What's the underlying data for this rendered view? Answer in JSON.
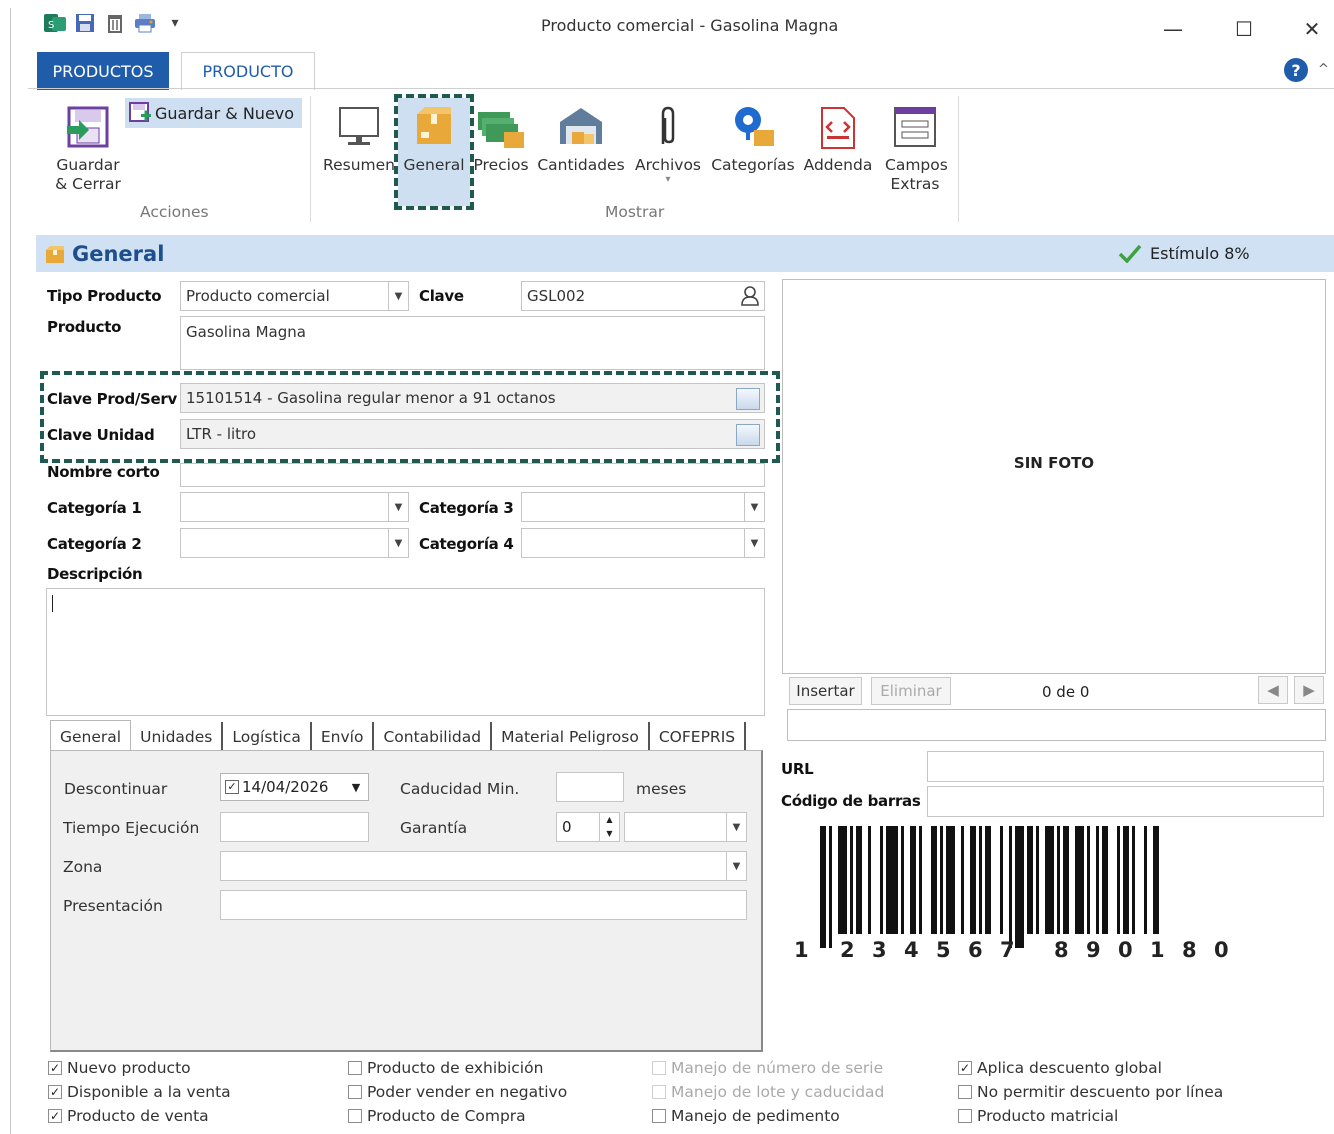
{
  "window": {
    "title": "Producto comercial - Gasolina Magna",
    "minimize": "—",
    "maximize": "☐",
    "close": "✕"
  },
  "quick_access": {
    "dropdown": "▾"
  },
  "ribbon_tabs": {
    "productos": "PRODUCTOS",
    "producto": "PRODUCTO"
  },
  "ribbon": {
    "acciones": {
      "label": "Acciones",
      "guardar_cerrar": "Guardar & Cerrar",
      "guardar_nuevo": "Guardar & Nuevo"
    },
    "mostrar": {
      "label": "Mostrar",
      "buttons": [
        {
          "label": "Resumen"
        },
        {
          "label": "General"
        },
        {
          "label": "Precios"
        },
        {
          "label": "Cantidades"
        },
        {
          "label": "Archivos"
        },
        {
          "label": "Categorías"
        },
        {
          "label": "Addenda"
        },
        {
          "label": "Campos Extras"
        }
      ]
    }
  },
  "section": {
    "title": "General",
    "badge": "Estímulo 8%"
  },
  "form": {
    "tipo_producto_label": "Tipo Producto",
    "tipo_producto_value": "Producto comercial",
    "clave_label": "Clave",
    "clave_value": "GSL002",
    "producto_label": "Producto",
    "producto_value": "Gasolina Magna",
    "clave_prodserv_label": "Clave Prod/Serv",
    "clave_prodserv_value": "15101514 - Gasolina regular menor a 91 octanos",
    "clave_unidad_label": "Clave Unidad",
    "clave_unidad_value": "LTR - litro",
    "nombre_corto_label": "Nombre corto",
    "categoria1_label": "Categoría 1",
    "categoria2_label": "Categoría 2",
    "categoria3_label": "Categoría 3",
    "categoria4_label": "Categoría 4",
    "descripcion_label": "Descripción"
  },
  "lower_tabs": [
    "General",
    "Unidades",
    "Logística",
    "Envío",
    "Contabilidad",
    "Material Peligroso",
    "COFEPRIS"
  ],
  "general_tab": {
    "descontinuar_label": "Descontinuar",
    "descontinuar_date": "14/04/2026",
    "caducidad_label": "Caducidad Min.",
    "meses_label": "meses",
    "tiempo_label": "Tiempo Ejecución",
    "garantia_label": "Garantía",
    "garantia_value": "0",
    "zona_label": "Zona",
    "presentacion_label": "Presentación"
  },
  "photo": {
    "placeholder": "SIN FOTO",
    "insertar": "Insertar",
    "eliminar": "Eliminar",
    "counter": "0 de 0"
  },
  "url_label": "URL",
  "barcode_label": "Código de barras",
  "barcode_digits": [
    "1",
    "2",
    "3",
    "4",
    "5",
    "6",
    "7",
    "8",
    "9",
    "0",
    "1",
    "8",
    "0"
  ],
  "checkboxes": [
    {
      "label": "Nuevo producto",
      "checked": true,
      "enabled": true
    },
    {
      "label": "Disponible a la venta",
      "checked": true,
      "enabled": true
    },
    {
      "label": "Producto de venta",
      "checked": true,
      "enabled": true
    },
    {
      "label": "Producto de exhibición",
      "checked": false,
      "enabled": true
    },
    {
      "label": "Poder vender en negativo",
      "checked": false,
      "enabled": true
    },
    {
      "label": "Producto de Compra",
      "checked": false,
      "enabled": true
    },
    {
      "label": "Manejo de número de serie",
      "checked": false,
      "enabled": false
    },
    {
      "label": "Manejo de lote y caducidad",
      "checked": false,
      "enabled": false
    },
    {
      "label": "Manejo de pedimento",
      "checked": false,
      "enabled": true
    },
    {
      "label": "Aplica descuento global",
      "checked": true,
      "enabled": true
    },
    {
      "label": "No permitir descuento por línea",
      "checked": false,
      "enabled": true
    },
    {
      "label": "Producto matricial",
      "checked": false,
      "enabled": true
    }
  ]
}
